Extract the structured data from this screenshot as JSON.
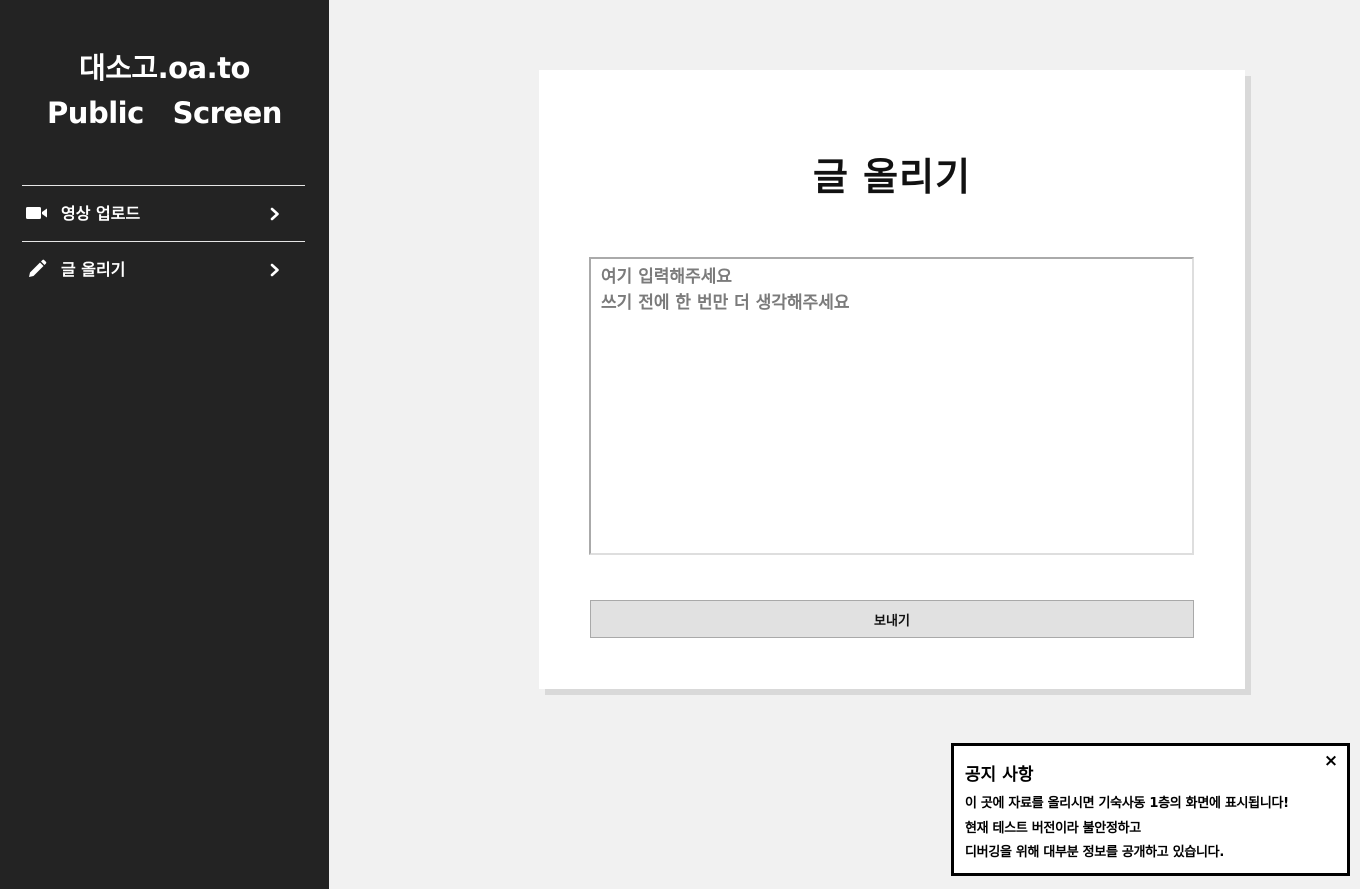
{
  "sidebar": {
    "brand_line1": "대소고.oa.to",
    "brand_line2": "Public   Screen",
    "items": [
      {
        "label": "영상 업로드",
        "icon": "video-camera-icon"
      },
      {
        "label": "글 올리기",
        "icon": "pencil-icon"
      }
    ]
  },
  "main": {
    "title": "글 올리기",
    "textarea_placeholder": "여기 입력해주세요\n쓰기 전에 한 번만 더 생각해주세요",
    "send_label": "보내기"
  },
  "notice": {
    "title": "공지 사항",
    "close_label": "×",
    "lines": [
      "이 곳에 자료를 올리시면 기숙사동 1층의 화면에 표시됩니다!",
      "현재 테스트 버전이라 불안정하고",
      "디버깅을 위해 대부분 정보를 공개하고 있습니다."
    ]
  },
  "colors": {
    "sidebar_bg": "#232323",
    "page_bg": "#f1f1f1",
    "card_bg": "#ffffff",
    "button_bg": "#e1e1e1"
  }
}
